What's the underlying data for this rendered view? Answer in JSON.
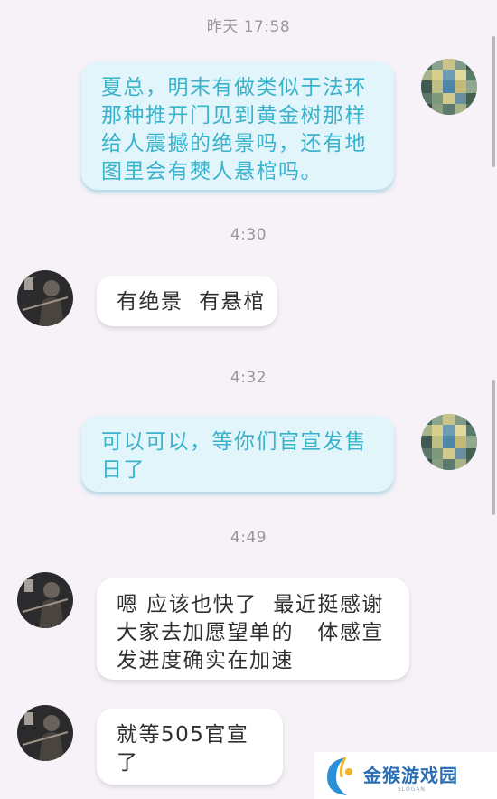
{
  "messages": [
    {
      "timestamp": "昨天 17:58",
      "sender": "me",
      "text": "夏总，明末有做类似于法环那种推开门见到黄金树那样给人震撼的绝景吗，还有地图里会有僰人悬棺吗。"
    },
    {
      "timestamp": "4:30",
      "sender": "them",
      "text": "有绝景  有悬棺"
    },
    {
      "timestamp": "4:32",
      "sender": "me",
      "text": "可以可以，等你们官宣发售日了"
    },
    {
      "timestamp": "4:49",
      "sender": "them",
      "text": "嗯 应该也快了  最近挺感谢大家去加愿望单的   体感宣发进度确实在加速"
    },
    {
      "timestamp": "",
      "sender": "them",
      "text": "就等505官宣了"
    }
  ],
  "watermark": {
    "text": "金猴游戏园",
    "subtext": "SLOGAN"
  },
  "colors": {
    "background": "#f6f2f7",
    "my_bubble": "#e2f5fb",
    "my_text": "#39b3cc",
    "their_bubble": "#ffffff",
    "their_text": "#2f2f2f",
    "timestamp": "#9a979c"
  },
  "icons": {
    "my_avatar": "pixelated-avatar",
    "their_avatar": "warrior-avatar",
    "watermark_logo": "monkey-logo-icon"
  }
}
